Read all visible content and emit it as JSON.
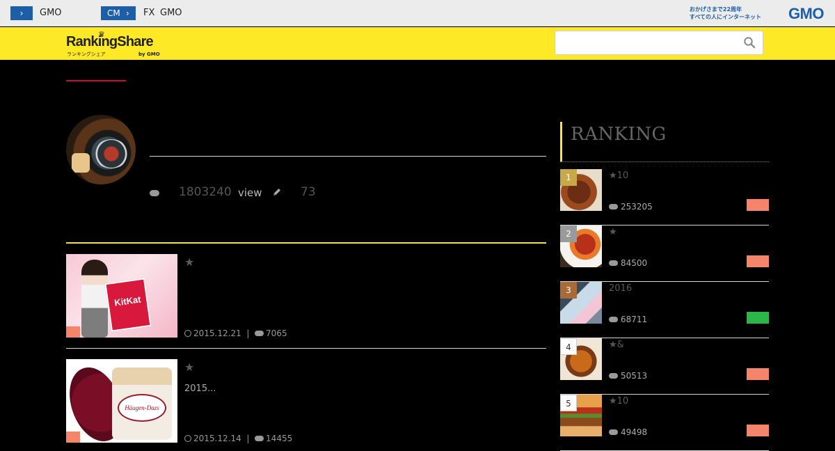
{
  "topbar": {
    "left_button_icon": "›",
    "left_text": "GMO",
    "cm_label": "CM",
    "cm_icon": "›",
    "fx_label": "FX",
    "gmo_label": "GMO",
    "tagline_line1": "おかげさまで22周年",
    "tagline_line2": "すべての人にインターネット",
    "gmo_logo": "GMO"
  },
  "header": {
    "logo_main": "RankingShare",
    "logo_crown": "♛",
    "logo_sub": "ランキングシェア",
    "logo_by": "by GMO",
    "search_placeholder": "",
    "search_icon": "search-icon"
  },
  "profile": {
    "view_count": "1803240",
    "view_unit": "view",
    "post_count": "73"
  },
  "articles": [
    {
      "star": "★",
      "excerpt": "",
      "date": "2015.12.21",
      "separator": "|",
      "views": "7065",
      "thumb_text": "KitKat"
    },
    {
      "star": "★",
      "excerpt": "2015...",
      "date": "2015.12.14",
      "separator": "|",
      "views": "14455",
      "thumb_text": "Häagen-Dazs"
    }
  ],
  "sidebar": {
    "heading": "RANKING",
    "items": [
      {
        "rank": "1",
        "title": "★10",
        "views": "253205",
        "rank_color": "#c8a94a",
        "category_color": "#f4846a"
      },
      {
        "rank": "2",
        "title": "★",
        "views": "84500",
        "rank_color": "#9a9a9a",
        "category_color": "#f4846a"
      },
      {
        "rank": "3",
        "title": "2016",
        "views": "68711",
        "rank_color": "#a86a36",
        "category_color": "#2bb64a"
      },
      {
        "rank": "4",
        "title": "★&",
        "views": "50513",
        "rank_color": "#ffffff",
        "category_color": "#f4846a"
      },
      {
        "rank": "5",
        "title": "★10",
        "views": "49498",
        "rank_color": "#ffffff",
        "category_color": "#f4846a"
      }
    ]
  },
  "colors": {
    "header_yellow": "#fde926",
    "accent_red": "#c8102e",
    "gmo_blue": "#1c5ea8",
    "divider_yellow": "#f7e34b"
  }
}
